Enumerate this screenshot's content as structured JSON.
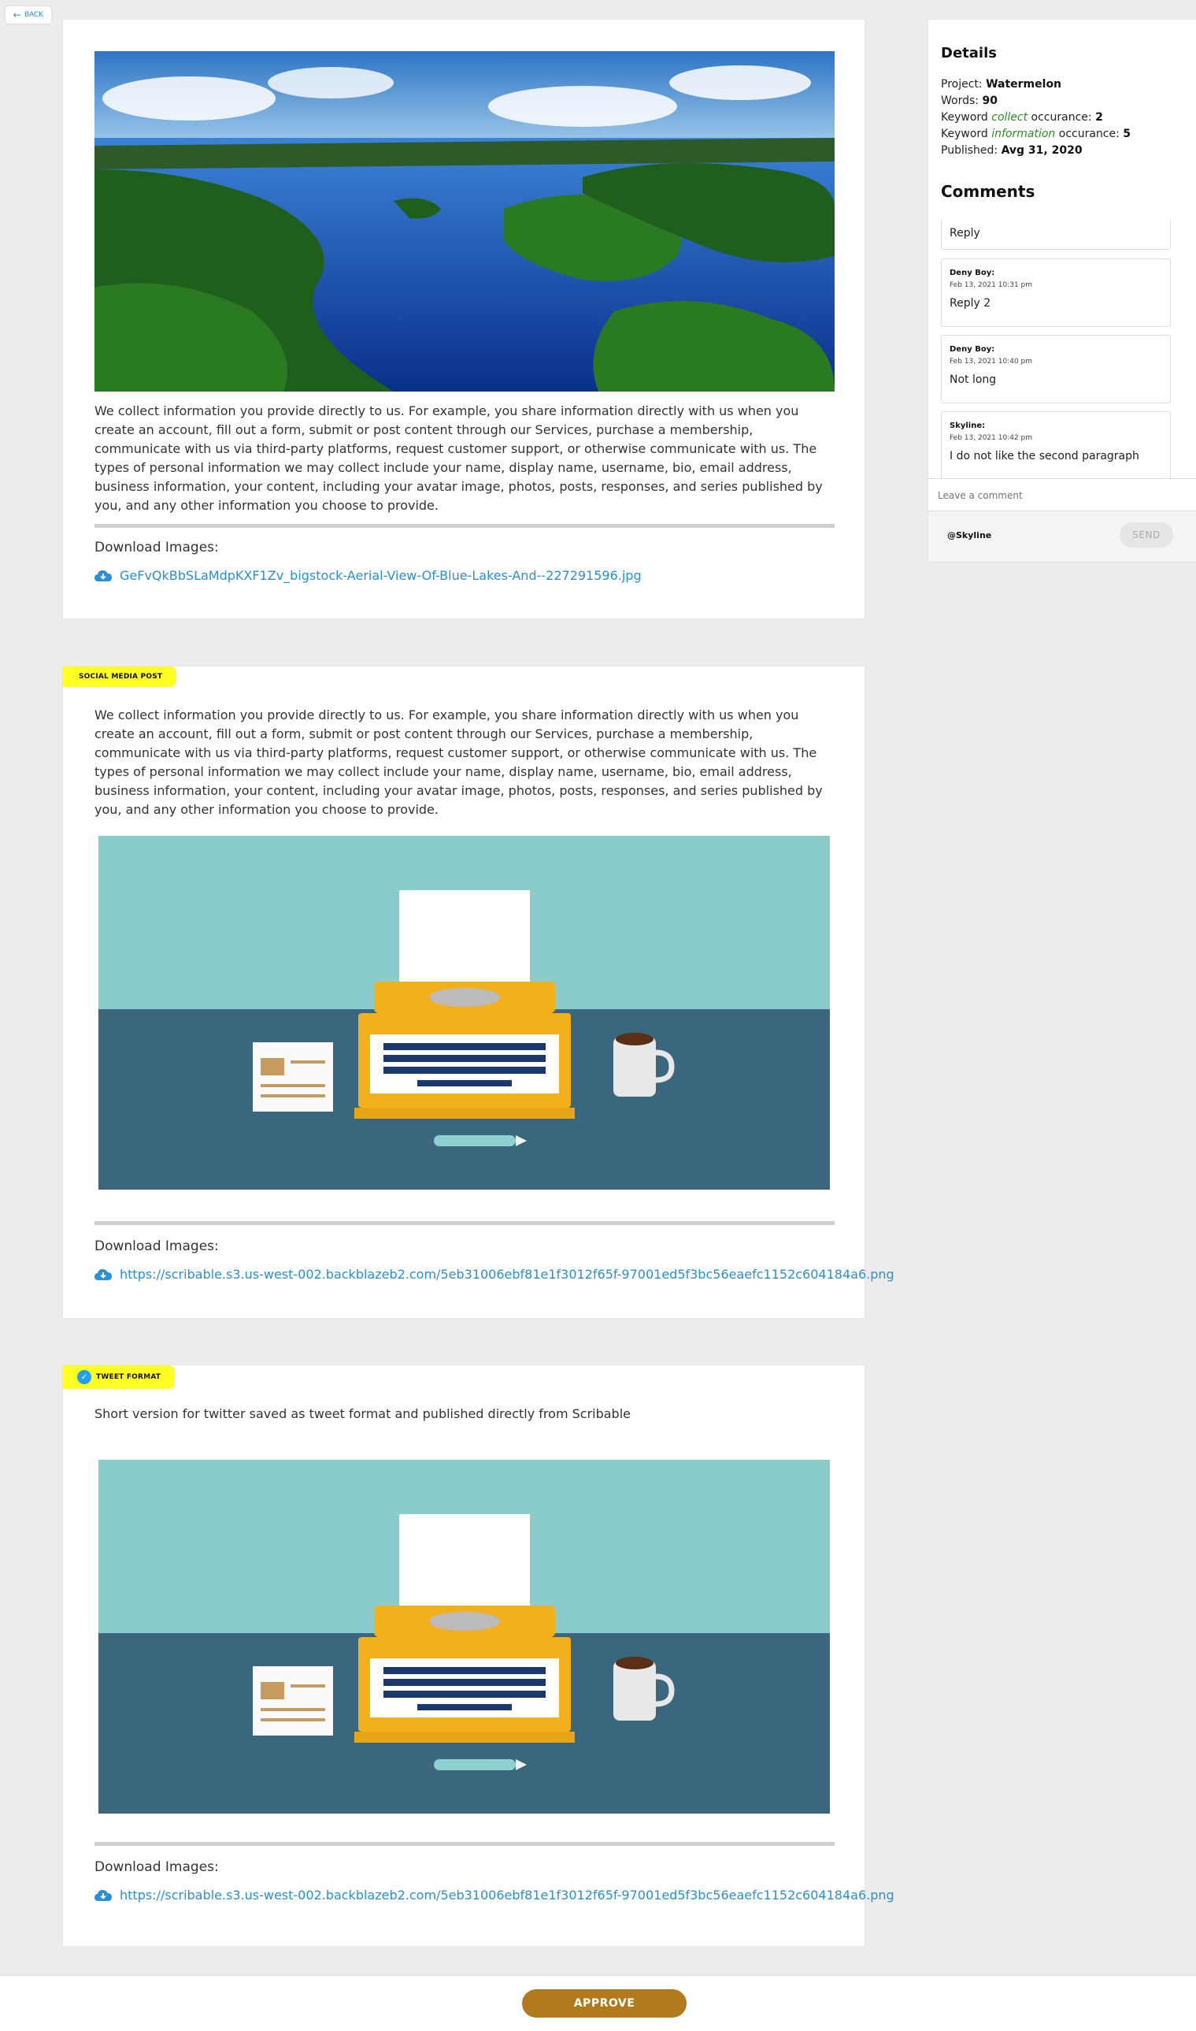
{
  "nav": {
    "back_label": "BACK"
  },
  "posts": [
    {
      "body": "We collect information you provide directly to us. For example, you share information directly with us when you create an account, fill out a form, submit or post content through our Services, purchase a membership, communicate with us via third-party platforms, request customer support, or otherwise communicate with us. The types of personal information we may collect include your name, display name, username, bio, email address, business information, your content, including your avatar image, photos, posts, responses, and series published by you, and any other information you choose to provide.",
      "download_label": "Download Images:",
      "download_link": "GeFvQkBbSLaMdpKXF1Zv_bigstock-Aerial-View-Of-Blue-Lakes-And--227291596.jpg"
    },
    {
      "badge": "SOCIAL MEDIA POST",
      "body": "We collect information you provide directly to us. For example, you share information directly with us when you create an account, fill out a form, submit or post content through our Services, purchase a membership, communicate with us via third-party platforms, request customer support, or otherwise communicate with us. The types of personal information we may collect include your name, display name, username, bio, email address, business information, your content, including your avatar image, photos, posts, responses, and series published by you, and any other information you choose to provide.",
      "download_label": "Download Images:",
      "download_link": "https://scribable.s3.us-west-002.backblazeb2.com/5eb31006ebf81e1f3012f65f-97001ed5f3bc56eaefc1152c604184a6.png"
    },
    {
      "badge": "TWEET FORMAT",
      "body": "Short version for twitter saved as tweet format and published directly from Scribable",
      "download_label": "Download Images:",
      "download_link": "https://scribable.s3.us-west-002.backblazeb2.com/5eb31006ebf81e1f3012f65f-97001ed5f3bc56eaefc1152c604184a6.png"
    }
  ],
  "details": {
    "title": "Details",
    "project_label": "Project:",
    "project_value": "Watermelon",
    "words_label": "Words:",
    "words_value": "90",
    "kw_prefix": "Keyword",
    "kw1_word": "collect",
    "kw1_suffix": "occurance:",
    "kw1_count": "2",
    "kw2_word": "information",
    "kw2_suffix": "occurance:",
    "kw2_count": "5",
    "published_label": "Published:",
    "published_value": "Avg 31, 2020"
  },
  "comments": {
    "title": "Comments",
    "items": [
      {
        "author": "",
        "time": "",
        "text": "Reply"
      },
      {
        "author": "Deny Boy:",
        "time": "Feb 13, 2021 10:31 pm",
        "text": "Reply 2"
      },
      {
        "author": "Deny Boy:",
        "time": "Feb 13, 2021 10:40 pm",
        "text": "Not long"
      },
      {
        "author": "Skyline:",
        "time": "Feb 13, 2021 10:42 pm",
        "text": "I do not like the second paragraph"
      }
    ],
    "input_placeholder": "Leave a comment",
    "mention": "@Skyline",
    "send_label": "SEND"
  },
  "approve_label": "APPROVE",
  "icons": {
    "back": "arrow-left-icon",
    "download": "cloud-download-icon",
    "twitter": "twitter-bird-icon"
  },
  "colors": {
    "accent_blue": "#2a8fd4",
    "badge_yellow": "#ffff26",
    "approve": "#b07a1d",
    "keyword_green": "#2e8b22"
  }
}
